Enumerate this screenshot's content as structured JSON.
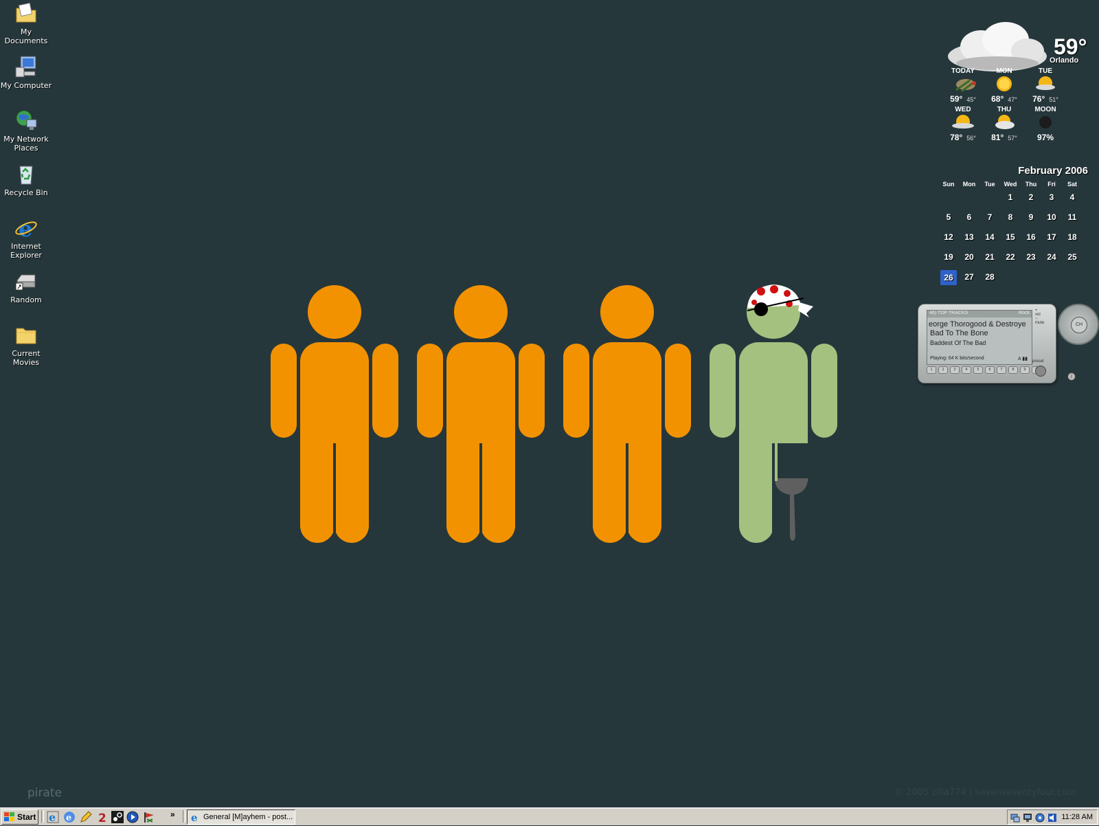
{
  "desktop": {
    "icons": [
      {
        "label": "My Documents"
      },
      {
        "label": "My Computer"
      },
      {
        "label": "My Network Places"
      },
      {
        "label": "Recycle Bin"
      },
      {
        "label": "Internet Explorer"
      },
      {
        "label": "Random"
      },
      {
        "label": "Current Movies"
      }
    ]
  },
  "wallpaper": {
    "caption": "pirate",
    "credit": "© 2005 zilla774 | sevenseventyfour.com",
    "colors": {
      "background": "#26373b",
      "figure": "#f39200",
      "pirate": "#a5c17f",
      "peg": "#5f5f5f"
    }
  },
  "weather": {
    "current_temp": "59°",
    "city": "Orlando",
    "days": [
      {
        "name": "TODAY",
        "hi": "59°",
        "lo": "45°",
        "icon": "cloudy-icon"
      },
      {
        "name": "MON",
        "hi": "68°",
        "lo": "47°",
        "icon": "sunny-icon"
      },
      {
        "name": "TUE",
        "hi": "76°",
        "lo": "51°",
        "icon": "partly-sunny-icon"
      },
      {
        "name": "WED",
        "hi": "78°",
        "lo": "56°",
        "icon": "partly-sunny-icon"
      },
      {
        "name": "THU",
        "hi": "81°",
        "lo": "57°",
        "icon": "partly-cloudy-icon"
      },
      {
        "name": "MOON",
        "hi": "97%",
        "lo": "",
        "icon": "moon-icon"
      }
    ]
  },
  "calendar": {
    "title": "February 2006",
    "weekdays": [
      "Sun",
      "Mon",
      "Tue",
      "Wed",
      "Thu",
      "Fri",
      "Sat"
    ],
    "weeks": [
      [
        "",
        "",
        "",
        "1",
        "2",
        "3",
        "4"
      ],
      [
        "5",
        "6",
        "7",
        "8",
        "9",
        "10",
        "11"
      ],
      [
        "12",
        "13",
        "14",
        "15",
        "16",
        "17",
        "18"
      ],
      [
        "19",
        "20",
        "21",
        "22",
        "23",
        "24",
        "25"
      ],
      [
        "26",
        "27",
        "28",
        "",
        "",
        "",
        ""
      ]
    ],
    "today": "26"
  },
  "radio": {
    "channel": "46) TOP TRACKS",
    "genre": "Rock",
    "artist": "eorge Thorogood & Destroye",
    "song": "Bad To The Bone",
    "album": "Baddest Of The Bad",
    "status": "Playing: 64 K bits/second",
    "signal": "A",
    "presets": [
      "1",
      "2",
      "3",
      "4",
      "5",
      "6",
      "7",
      "8",
      "9",
      "0"
    ],
    "dial_label": "CH",
    "vol_label": "vol",
    "mute_label": "mute",
    "preset_label": "preset",
    "info_label": "i"
  },
  "taskbar": {
    "start_label": "Start",
    "quicklaunch_overflow": "»",
    "window_title": "General [M]ayhem - post...",
    "clock": "11:28 AM"
  }
}
